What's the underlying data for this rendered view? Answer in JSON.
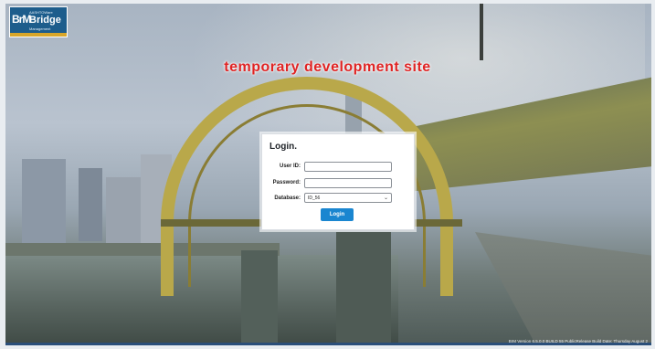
{
  "app": {
    "logo_mark": "BrM",
    "logo_sub": "AASHTOWare",
    "logo_name": "Bridge",
    "logo_tag": "Management"
  },
  "banner": {
    "dev_notice": "temporary development site",
    "color": "#e02424"
  },
  "login": {
    "title": "Login.",
    "user_id_label": "User ID:",
    "user_id_value": "",
    "password_label": "Password:",
    "password_value": "",
    "database_label": "Database:",
    "database_selected": "ID_56",
    "button_label": "Login",
    "accent": "#1a86d0"
  },
  "footer": {
    "version_text": "BrM Version 6.5.0.0 BUILD 55 PublicRelease Build Date: Thursday August 2"
  }
}
